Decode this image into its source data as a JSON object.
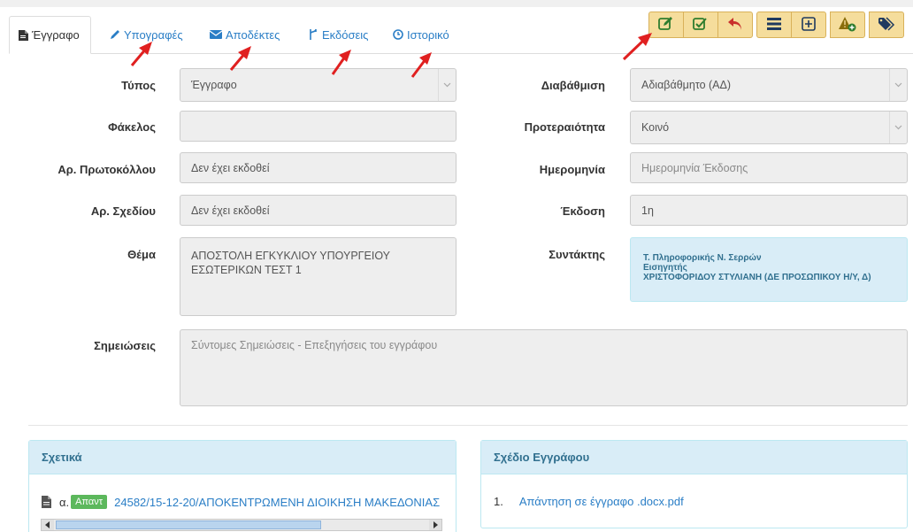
{
  "tabs": [
    {
      "label": "Έγγραφο",
      "icon": "document-icon",
      "active": true
    },
    {
      "label": "Υπογραφές",
      "icon": "pencil-icon"
    },
    {
      "label": "Αποδέκτες",
      "icon": "envelope-icon"
    },
    {
      "label": "Εκδόσεις",
      "icon": "fork-icon"
    },
    {
      "label": "Ιστορικό",
      "icon": "clock-icon"
    }
  ],
  "toolbar": {
    "buttons": [
      "edit-icon",
      "check-square-icon",
      "reply-icon",
      "list-icon",
      "plus-square-icon",
      "warning-add-icon",
      "tag-icon"
    ]
  },
  "form": {
    "type_label": "Τύπος",
    "type_value": "Έγγραφο",
    "folder_label": "Φάκελος",
    "folder_value": "",
    "protocol_label": "Αρ. Πρωτοκόλλου",
    "protocol_value": "Δεν έχει εκδοθεί",
    "draft_label": "Αρ. Σχεδίου",
    "draft_value": "Δεν έχει εκδοθεί",
    "subject_label": "Θέμα",
    "subject_value": "ΑΠΟΣΤΟΛΗ ΕΓΚΥΚΛΙΟΥ ΥΠΟΥΡΓΕΙΟΥ ΕΣΩΤΕΡΙΚΩΝ ΤΕΣΤ 1",
    "classification_label": "Διαβάθμιση",
    "classification_value": "Αδιαβάθμητο (ΑΔ)",
    "priority_label": "Προτεραιότητα",
    "priority_value": "Κοινό",
    "date_label": "Ημερομηνία",
    "date_placeholder": "Ημερομηνία Έκδοσης",
    "version_label": "Έκδοση",
    "version_value": "1η",
    "author_label": "Συντάκτης",
    "author_line1": "Τ. Πληροφορικής Ν. Σερρών",
    "author_line2": "Εισηγητής",
    "author_line3": "ΧΡΙΣΤΟΦΟΡΙΔΟΥ ΣΤΥΛΙΑΝΗ (ΔΕ ΠΡΟΣΩΠΙΚΟΥ Η/Υ, Δ)",
    "notes_label": "Σημειώσεις",
    "notes_placeholder": "Σύντομες Σημειώσεις - Επεξηγήσεις του εγγράφου"
  },
  "related": {
    "title": "Σχετικά",
    "item_prefix": "α.",
    "item_badge": "Απαντ",
    "item_text": "24582/15-12-20/ΑΠΟΚΕΝΤΡΩΜΕΝΗ ΔΙΟΙΚΗΣΗ ΜΑΚΕΔΟΝΙΑΣ"
  },
  "draft_doc": {
    "title": "Σχέδιο Εγγράφου",
    "item_number": "1.",
    "item_text": "Απάντηση σε έγγραφο .docx.pdf"
  },
  "colors": {
    "link": "#2a7ec6",
    "toolbar_button": "#f5dd9c",
    "panel_header": "#d9edf7",
    "badge_green": "#5cb85c",
    "annotation_arrow": "#e02020"
  }
}
